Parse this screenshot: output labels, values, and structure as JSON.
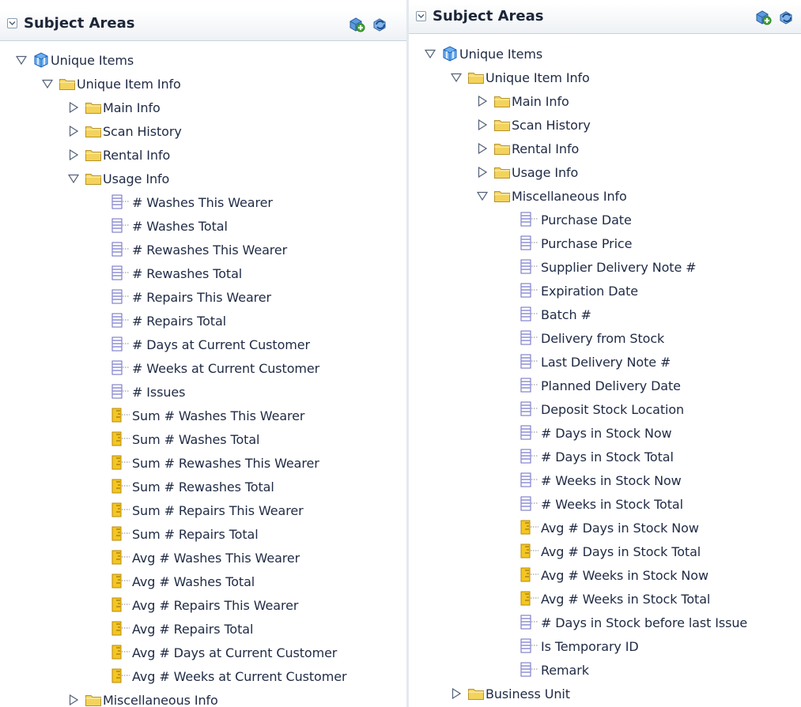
{
  "left": {
    "title": "Subject Areas",
    "tree": [
      {
        "label": "Unique Items",
        "depth": 0,
        "type": "subject",
        "toggle": "expanded"
      },
      {
        "label": "Unique Item Info",
        "depth": 1,
        "type": "folder",
        "toggle": "expanded"
      },
      {
        "label": "Main Info",
        "depth": 2,
        "type": "folder",
        "toggle": "collapsed"
      },
      {
        "label": "Scan History",
        "depth": 2,
        "type": "folder",
        "toggle": "collapsed"
      },
      {
        "label": "Rental Info",
        "depth": 2,
        "type": "folder",
        "toggle": "collapsed"
      },
      {
        "label": "Usage Info",
        "depth": 2,
        "type": "folder",
        "toggle": "expanded"
      },
      {
        "label": "# Washes This Wearer",
        "depth": 3,
        "type": "column",
        "toggle": "none"
      },
      {
        "label": "# Washes Total",
        "depth": 3,
        "type": "column",
        "toggle": "none"
      },
      {
        "label": "# Rewashes This Wearer",
        "depth": 3,
        "type": "column",
        "toggle": "none"
      },
      {
        "label": "# Rewashes Total",
        "depth": 3,
        "type": "column",
        "toggle": "none"
      },
      {
        "label": "# Repairs This Wearer",
        "depth": 3,
        "type": "column",
        "toggle": "none"
      },
      {
        "label": "# Repairs Total",
        "depth": 3,
        "type": "column",
        "toggle": "none"
      },
      {
        "label": "# Days at Current Customer",
        "depth": 3,
        "type": "column",
        "toggle": "none"
      },
      {
        "label": "# Weeks at Current Customer",
        "depth": 3,
        "type": "column",
        "toggle": "none"
      },
      {
        "label": "# Issues",
        "depth": 3,
        "type": "column",
        "toggle": "none"
      },
      {
        "label": "Sum # Washes This Wearer",
        "depth": 3,
        "type": "measure",
        "toggle": "none"
      },
      {
        "label": "Sum # Washes Total",
        "depth": 3,
        "type": "measure",
        "toggle": "none"
      },
      {
        "label": "Sum # Rewashes This Wearer",
        "depth": 3,
        "type": "measure",
        "toggle": "none"
      },
      {
        "label": "Sum # Rewashes Total",
        "depth": 3,
        "type": "measure",
        "toggle": "none"
      },
      {
        "label": "Sum # Repairs This Wearer",
        "depth": 3,
        "type": "measure",
        "toggle": "none"
      },
      {
        "label": "Sum # Repairs Total",
        "depth": 3,
        "type": "measure",
        "toggle": "none"
      },
      {
        "label": "Avg # Washes This Wearer",
        "depth": 3,
        "type": "measure",
        "toggle": "none"
      },
      {
        "label": "Avg # Washes Total",
        "depth": 3,
        "type": "measure",
        "toggle": "none"
      },
      {
        "label": "Avg # Repairs This Wearer",
        "depth": 3,
        "type": "measure",
        "toggle": "none"
      },
      {
        "label": "Avg # Repairs Total",
        "depth": 3,
        "type": "measure",
        "toggle": "none"
      },
      {
        "label": "Avg # Days at Current Customer",
        "depth": 3,
        "type": "measure",
        "toggle": "none"
      },
      {
        "label": "Avg # Weeks at Current Customer",
        "depth": 3,
        "type": "measure",
        "toggle": "none"
      },
      {
        "label": "Miscellaneous Info",
        "depth": 2,
        "type": "folder",
        "toggle": "collapsed"
      }
    ]
  },
  "right": {
    "title": "Subject Areas",
    "tree": [
      {
        "label": "Unique Items",
        "depth": 0,
        "type": "subject",
        "toggle": "expanded"
      },
      {
        "label": "Unique Item Info",
        "depth": 1,
        "type": "folder",
        "toggle": "expanded"
      },
      {
        "label": "Main Info",
        "depth": 2,
        "type": "folder",
        "toggle": "collapsed"
      },
      {
        "label": "Scan History",
        "depth": 2,
        "type": "folder",
        "toggle": "collapsed"
      },
      {
        "label": "Rental Info",
        "depth": 2,
        "type": "folder",
        "toggle": "collapsed"
      },
      {
        "label": "Usage Info",
        "depth": 2,
        "type": "folder",
        "toggle": "collapsed"
      },
      {
        "label": "Miscellaneous Info",
        "depth": 2,
        "type": "folder",
        "toggle": "expanded"
      },
      {
        "label": "Purchase Date",
        "depth": 3,
        "type": "column",
        "toggle": "none"
      },
      {
        "label": "Purchase Price",
        "depth": 3,
        "type": "column",
        "toggle": "none"
      },
      {
        "label": "Supplier Delivery Note #",
        "depth": 3,
        "type": "column",
        "toggle": "none"
      },
      {
        "label": "Expiration Date",
        "depth": 3,
        "type": "column",
        "toggle": "none"
      },
      {
        "label": "Batch #",
        "depth": 3,
        "type": "column",
        "toggle": "none"
      },
      {
        "label": "Delivery from Stock",
        "depth": 3,
        "type": "column",
        "toggle": "none"
      },
      {
        "label": "Last Delivery Note #",
        "depth": 3,
        "type": "column",
        "toggle": "none"
      },
      {
        "label": "Planned Delivery Date",
        "depth": 3,
        "type": "column",
        "toggle": "none"
      },
      {
        "label": "Deposit Stock Location",
        "depth": 3,
        "type": "column",
        "toggle": "none"
      },
      {
        "label": "# Days in Stock Now",
        "depth": 3,
        "type": "column",
        "toggle": "none"
      },
      {
        "label": "# Days in Stock Total",
        "depth": 3,
        "type": "column",
        "toggle": "none"
      },
      {
        "label": "# Weeks in Stock Now",
        "depth": 3,
        "type": "column",
        "toggle": "none"
      },
      {
        "label": "# Weeks in Stock Total",
        "depth": 3,
        "type": "column",
        "toggle": "none"
      },
      {
        "label": "Avg # Days in Stock Now",
        "depth": 3,
        "type": "measure",
        "toggle": "none"
      },
      {
        "label": "Avg # Days in Stock Total",
        "depth": 3,
        "type": "measure",
        "toggle": "none"
      },
      {
        "label": "Avg # Weeks in Stock Now",
        "depth": 3,
        "type": "measure",
        "toggle": "none"
      },
      {
        "label": "Avg # Weeks in Stock Total",
        "depth": 3,
        "type": "measure",
        "toggle": "none"
      },
      {
        "label": "# Days in Stock before last Issue",
        "depth": 3,
        "type": "column",
        "toggle": "none"
      },
      {
        "label": "Is Temporary ID",
        "depth": 3,
        "type": "column",
        "toggle": "none"
      },
      {
        "label": "Remark",
        "depth": 3,
        "type": "column",
        "toggle": "none"
      },
      {
        "label": "Business Unit",
        "depth": 1,
        "type": "folder",
        "toggle": "collapsed"
      }
    ]
  },
  "icons": {
    "header_left": "collapse-panel-icon",
    "header_add": "add-subject-area-icon",
    "header_refresh": "refresh-icon",
    "subject": "subject-area-icon",
    "folder": "folder-icon",
    "column": "column-icon",
    "measure": "measure-icon"
  },
  "colors": {
    "header_bg": "#eef1f5",
    "folder": "#f5d96b",
    "column": "#8f8fd8",
    "measure": "#f0c419",
    "subject": "#3a8ee6",
    "text": "#1f2a44"
  }
}
